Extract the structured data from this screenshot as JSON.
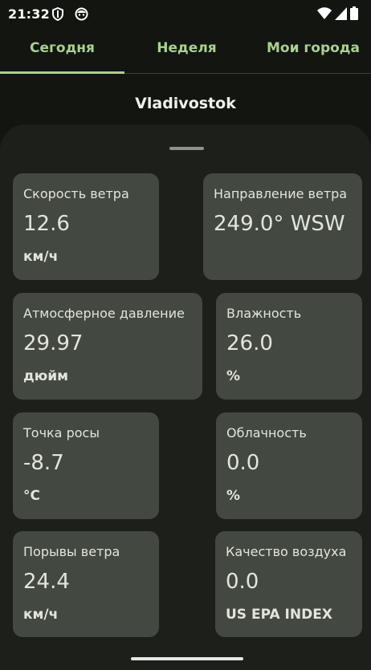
{
  "status_bar": {
    "time": "21:32"
  },
  "tabs": [
    {
      "label": "Сегодня"
    },
    {
      "label": "Неделя"
    },
    {
      "label": "Мои города"
    }
  ],
  "city": "Vladivostok",
  "cards": [
    {
      "label": "Скорость ветра",
      "value": "12.6",
      "unit": "км/ч"
    },
    {
      "label": "Направление ветра",
      "value": "249.0° WSW",
      "unit": ""
    },
    {
      "label": "Атмосферное давление",
      "value": "29.97",
      "unit": "дюйм"
    },
    {
      "label": "Влажность",
      "value": "26.0",
      "unit": "%"
    },
    {
      "label": "Точка росы",
      "value": "-8.7",
      "unit": "°C"
    },
    {
      "label": "Облачность",
      "value": "0.0",
      "unit": "%"
    },
    {
      "label": "Порывы ветра",
      "value": "24.4",
      "unit": "км/ч"
    },
    {
      "label": "Качество воздуха",
      "value": "0.0",
      "unit": "US EPA INDEX"
    }
  ],
  "colors": {
    "background": "#121510",
    "sheet": "#1c1f1a",
    "card": "#434840",
    "accent": "#a8d28d"
  }
}
